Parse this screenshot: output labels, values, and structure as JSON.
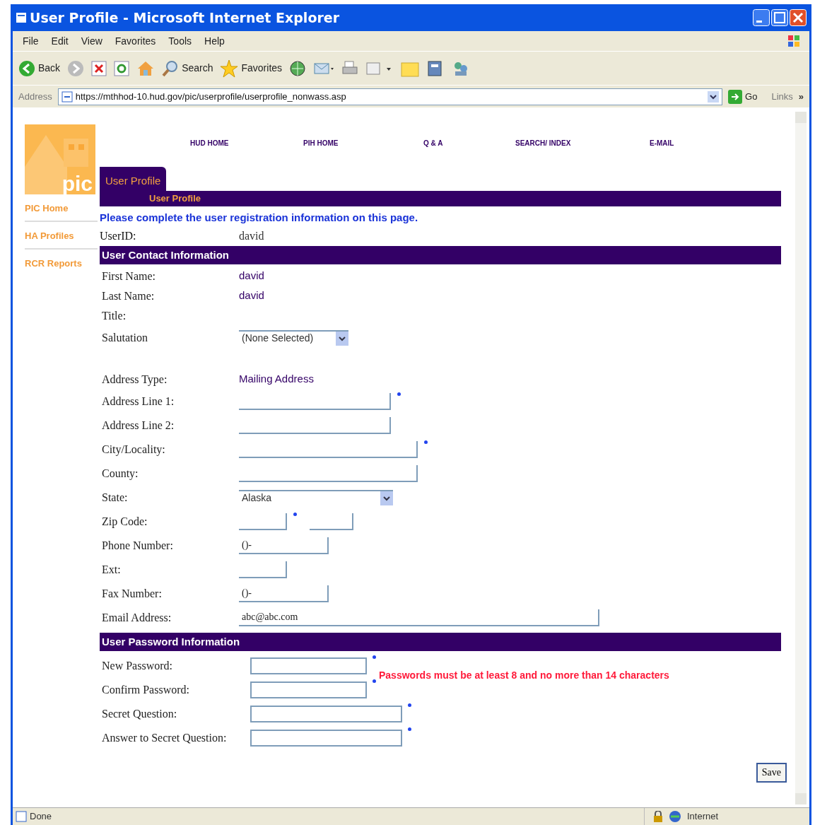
{
  "window": {
    "title": "User Profile - Microsoft Internet Explorer"
  },
  "menu": [
    "File",
    "Edit",
    "View",
    "Favorites",
    "Tools",
    "Help"
  ],
  "toolbar": {
    "back": "Back",
    "search": "Search",
    "favorites": "Favorites"
  },
  "address_bar": {
    "label": "Address",
    "url": "https://mthhod-10.hud.gov/pic/userprofile/userprofile_nonwass.asp",
    "go": "Go",
    "links": "Links",
    "more": "»"
  },
  "logo": {
    "text": "pic"
  },
  "top_nav": [
    "HUD HOME",
    "PIH HOME",
    "Q & A",
    "SEARCH/ INDEX",
    "E-MAIL"
  ],
  "sidebar": {
    "items": [
      "PIC Home",
      "HA Profiles",
      "RCR Reports"
    ]
  },
  "tab": {
    "label": "User Profile",
    "selected": true
  },
  "page_heading": "User Profile",
  "intro": "Please complete the user registration information on this page.",
  "user_id": {
    "label": "UserID:",
    "value": "david"
  },
  "contact_section": {
    "title": "User Contact Information",
    "fields": [
      {
        "kind": "text",
        "label": "First Name:",
        "value": "david"
      },
      {
        "kind": "text",
        "label": "Last Name:",
        "value": "david"
      },
      {
        "kind": "text",
        "label": "Title:"
      },
      {
        "kind": "select",
        "label": "Salutation",
        "value": "(None Selected)"
      },
      {
        "kind": "text",
        "label": "Address Type:",
        "value": "Mailing Address"
      },
      {
        "kind": "input",
        "label": "Address Line 1:",
        "required": true
      },
      {
        "kind": "input",
        "label": "Address Line 2:",
        "required": false
      },
      {
        "kind": "input",
        "label": "City/Locality:",
        "required": true
      },
      {
        "kind": "input",
        "label": "County:",
        "required": false
      },
      {
        "kind": "select",
        "label": "State:",
        "value": "Alaska"
      },
      {
        "kind": "zip",
        "label": "Zip Code:",
        "required": true
      },
      {
        "kind": "input",
        "label": "Phone Number:",
        "value": "()-",
        "required": false
      },
      {
        "kind": "input",
        "label": "Ext:",
        "required": false
      },
      {
        "kind": "input",
        "label": "Fax Number:",
        "value": "()-",
        "required": false
      },
      {
        "kind": "input",
        "label": "Email Address:",
        "value": "abc@abc.com",
        "required": false
      }
    ]
  },
  "password_section": {
    "title": "User Password Information",
    "note": "Passwords must be at least 8 and no more than 14 characters",
    "fields": [
      {
        "label": "New Password:",
        "required": true
      },
      {
        "label": "Confirm Password:",
        "required": true
      },
      {
        "label": "Secret Question:",
        "required": true
      },
      {
        "label": "Answer to Secret Question:",
        "required": true
      }
    ]
  },
  "save_button": "Save",
  "status_bar": {
    "text": "Done",
    "zone": "Internet"
  }
}
